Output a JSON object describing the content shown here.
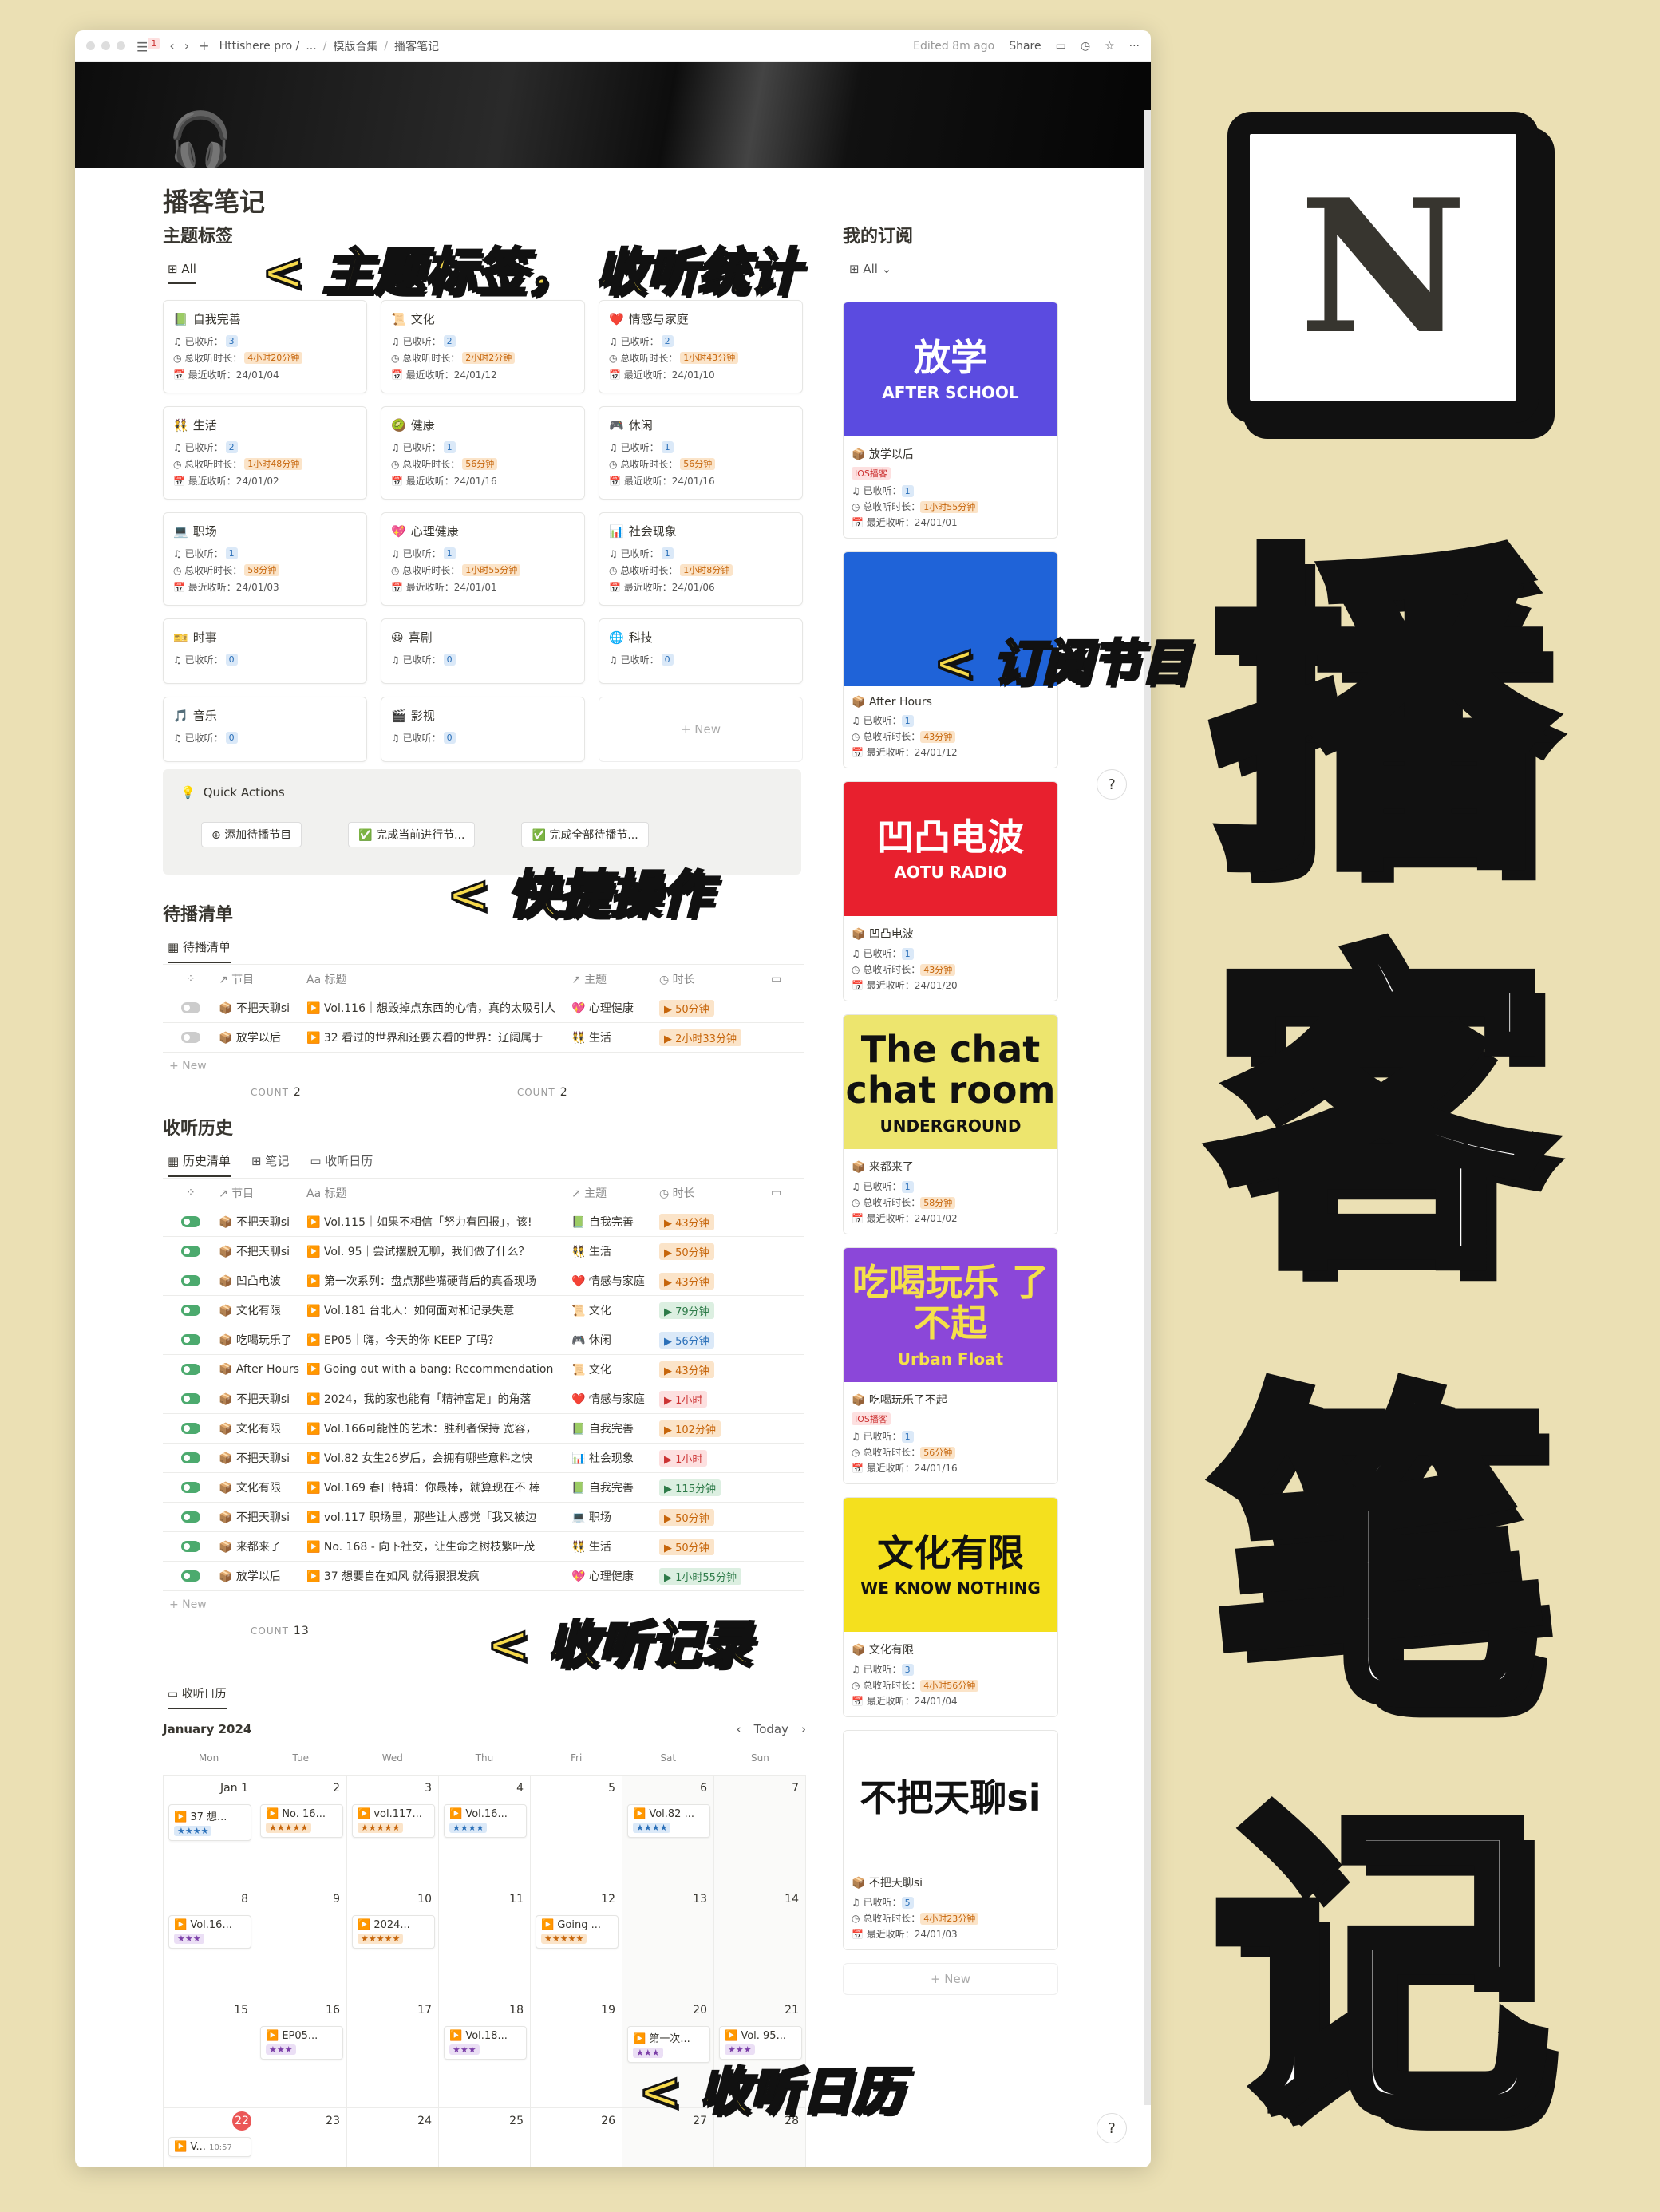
{
  "topbar": {
    "badge": "1",
    "workspace": "Httishere pro /",
    "ellipsis": "...",
    "sep1": "/",
    "crumb2": "模版合集",
    "sep2": "/",
    "crumb3": "播客笔记",
    "edited": "Edited 8m ago",
    "share": "Share"
  },
  "page": {
    "title": "播客笔记"
  },
  "topics": {
    "heading": "主题标签",
    "view": "All",
    "stats": {
      "listened": "已收听：",
      "duration": "总收听时长：",
      "recent": "最近收听："
    },
    "items": [
      {
        "icon": "📗",
        "name": "自我完善",
        "count": "3",
        "dur": "4小时20分钟",
        "date": "24/01/04"
      },
      {
        "icon": "📜",
        "name": "文化",
        "count": "2",
        "dur": "2小时2分钟",
        "date": "24/01/12"
      },
      {
        "icon": "❤️",
        "name": "情感与家庭",
        "count": "2",
        "dur": "1小时43分钟",
        "date": "24/01/10"
      },
      {
        "icon": "👯",
        "name": "生活",
        "count": "2",
        "dur": "1小时48分钟",
        "date": "24/01/02"
      },
      {
        "icon": "🥝",
        "name": "健康",
        "count": "1",
        "dur": "56分钟",
        "date": "24/01/16"
      },
      {
        "icon": "🎮",
        "name": "休闲",
        "count": "1",
        "dur": "56分钟",
        "date": "24/01/16"
      },
      {
        "icon": "💻",
        "name": "职场",
        "count": "1",
        "dur": "58分钟",
        "date": "24/01/03"
      },
      {
        "icon": "💖",
        "name": "心理健康",
        "count": "1",
        "dur": "1小时55分钟",
        "date": "24/01/01"
      },
      {
        "icon": "📊",
        "name": "社会现象",
        "count": "1",
        "dur": "1小时8分钟",
        "date": "24/01/06"
      },
      {
        "icon": "🎫",
        "name": "时事",
        "count": "0"
      },
      {
        "icon": "😀",
        "name": "喜剧",
        "count": "0"
      },
      {
        "icon": "🌐",
        "name": "科技",
        "count": "0"
      },
      {
        "icon": "🎵",
        "name": "音乐",
        "count": "0"
      },
      {
        "icon": "🎬",
        "name": "影视",
        "count": "0"
      }
    ],
    "new": "+ New"
  },
  "quick": {
    "heading": "Quick Actions",
    "b1": "添加待播节目",
    "b2": "完成当前进行节...",
    "b3": "完成全部待播节..."
  },
  "queue": {
    "heading": "待播清单",
    "view": "待播清单",
    "cols": {
      "c1": "↗ 节目",
      "c2": "Aa 标题",
      "c3": "↗ 主题",
      "c4": "◷ 时长"
    },
    "rows": [
      {
        "show": "不把天聊si",
        "title": "Vol.116｜想毁掉点东西的心情，真的太吸引人",
        "topic": "心理健康",
        "tcolor": "#c33",
        "dur": "50分钟"
      },
      {
        "show": "放学以后",
        "title": "32 看过的世界和还要去看的世界：辽阔属于",
        "topic": "生活",
        "tcolor": "#7b3fa8",
        "dur": "2小时33分钟"
      }
    ],
    "new": "+ New",
    "count_label": "COUNT",
    "count1": "2",
    "count2": "2"
  },
  "history": {
    "heading": "收听历史",
    "tab1": "历史清单",
    "tab2": "笔记",
    "tab3": "收听日历",
    "rows": [
      {
        "show": "不把天聊si",
        "title": "Vol.115｜如果不相信「努力有回报」，该!",
        "topic": "自我完善",
        "dur": "43分钟",
        "dc": "or"
      },
      {
        "show": "不把天聊si",
        "title": "Vol. 95｜尝试摆脱无聊，我们做了什么？",
        "topic": "生活",
        "dur": "50分钟",
        "dc": "or"
      },
      {
        "show": "凹凸电波",
        "title": "第一次系列：盘点那些嘴硬背后的真香现场",
        "topic": "情感与家庭",
        "dur": "43分钟",
        "dc": "or"
      },
      {
        "show": "文化有限",
        "title": "Vol.181 台北人：如何面对和记录失意",
        "topic": "文化",
        "dur": "79分钟",
        "dc": "grn"
      },
      {
        "show": "吃喝玩乐了",
        "title": "EP05｜嗨，今天的你 KEEP 了吗？",
        "topic": "休闲",
        "dur": "56分钟",
        "dc": "blue"
      },
      {
        "show": "After Hours",
        "title": "Going out with a bang: Recommendation",
        "topic": "文化",
        "dur": "43分钟",
        "dc": "or"
      },
      {
        "show": "不把天聊si",
        "title": "2024，我的家也能有「精神富足」的角落",
        "topic": "情感与家庭",
        "dur": "1小时",
        "dc": "red"
      },
      {
        "show": "文化有限",
        "title": "Vol.166可能性的艺术：胜利者保持 宽容，",
        "topic": "自我完善",
        "dur": "102分钟",
        "dc": "or"
      },
      {
        "show": "不把天聊si",
        "title": "Vol.82 女生26岁后，会拥有哪些意料之快",
        "topic": "社会现象",
        "dur": "1小时",
        "dc": "red"
      },
      {
        "show": "文化有限",
        "title": "Vol.169 春日特辑：你最棒，就算现在不 棒",
        "topic": "自我完善",
        "dur": "115分钟",
        "dc": "grn"
      },
      {
        "show": "不把天聊si",
        "title": "vol.117 职场里，那些让人感觉「我又被边",
        "topic": "职场",
        "dur": "50分钟",
        "dc": "or"
      },
      {
        "show": "来都来了",
        "title": "No. 168 - 向下社交，让生命之树枝繁叶茂",
        "topic": "生活",
        "dur": "50分钟",
        "dc": "or"
      },
      {
        "show": "放学以后",
        "title": "37 想要自在如风 就得狠狠发疯",
        "topic": "心理健康",
        "dur": "1小时55分钟",
        "dc": "grn"
      }
    ],
    "new": "+ New",
    "count": "13"
  },
  "calendar": {
    "view": "收听日历",
    "month": "January 2024",
    "today": "Today",
    "dow": [
      "Mon",
      "Tue",
      "Wed",
      "Thu",
      "Fri",
      "Sat",
      "Sun"
    ],
    "days": [
      {
        "d": "Jan 1",
        "ev": "37 想...",
        "st": "★★★★",
        "c": "blue"
      },
      {
        "d": "2",
        "ev": "No. 16...",
        "st": "★★★★★",
        "c": "or"
      },
      {
        "d": "3",
        "ev": "vol.117...",
        "st": "★★★★★",
        "c": "or"
      },
      {
        "d": "4",
        "ev": "Vol.16...",
        "st": "★★★★",
        "c": "blue"
      },
      {
        "d": "5"
      },
      {
        "d": "6",
        "ev": "Vol.82 ...",
        "st": "★★★★",
        "c": "blue"
      },
      {
        "d": "7"
      },
      {
        "d": "8",
        "ev": "Vol.16...",
        "st": "★★★",
        "c": "pur"
      },
      {
        "d": "9"
      },
      {
        "d": "10",
        "ev": "2024...",
        "st": "★★★★★",
        "c": "or"
      },
      {
        "d": "11"
      },
      {
        "d": "12",
        "ev": "Going ...",
        "st": "★★★★★",
        "c": "or"
      },
      {
        "d": "13"
      },
      {
        "d": "14"
      },
      {
        "d": "15"
      },
      {
        "d": "16",
        "ev": "EP05...",
        "st": "★★★",
        "c": "pur"
      },
      {
        "d": "17"
      },
      {
        "d": "18",
        "ev": "Vol.18...",
        "st": "★★★",
        "c": "pur"
      },
      {
        "d": "19"
      },
      {
        "d": "20",
        "ev": "第一次...",
        "st": "★★★",
        "c": "pur"
      },
      {
        "d": "21",
        "ev": "Vol. 95...",
        "st": "★★★",
        "c": "pur"
      },
      {
        "d": "22",
        "today": true,
        "ev": "V...",
        "time": "10:57"
      },
      {
        "d": "23"
      },
      {
        "d": "24"
      },
      {
        "d": "25"
      },
      {
        "d": "26"
      },
      {
        "d": "27"
      },
      {
        "d": "28"
      }
    ]
  },
  "subs": {
    "heading": "我的订阅",
    "view": "All",
    "items": [
      {
        "img": "放学",
        "img2": "AFTER SCHOOL",
        "bg": "#5b4be0",
        "fg": "#fff",
        "name": "放学以后",
        "ios": "IOS播客",
        "count": "1",
        "dur": "1小时55分钟",
        "date": "24/01/01"
      },
      {
        "img": "",
        "img2": "",
        "bg": "#1f63d8",
        "fg": "#fff",
        "name": "After Hours",
        "count": "1",
        "dur": "43分钟",
        "date": "24/01/12"
      },
      {
        "img": "凹凸电波",
        "img2": "AOTU RADIO",
        "bg": "#e8202e",
        "fg": "#fff",
        "name": "凹凸电波",
        "count": "1",
        "dur": "43分钟",
        "date": "24/01/20"
      },
      {
        "img": "The chat chat room",
        "img2": "UNDERGROUND",
        "bg": "#ede56e",
        "fg": "#111",
        "name": "来都来了",
        "count": "1",
        "dur": "58分钟",
        "date": "24/01/02"
      },
      {
        "img": "吃喝玩乐 了不起",
        "img2": "Urban Float",
        "bg": "#8b47d9",
        "fg": "#f5e04a",
        "name": "吃喝玩乐了不起",
        "ios": "IOS播客",
        "count": "1",
        "dur": "56分钟",
        "date": "24/01/16"
      },
      {
        "img": "文化有限",
        "img2": "WE KNOW NOTHING",
        "bg": "#f4e01e",
        "fg": "#111",
        "name": "文化有限",
        "count": "3",
        "dur": "4小时56分钟",
        "date": "24/01/04"
      },
      {
        "img": "不把天聊si",
        "img2": "",
        "bg": "#fff",
        "fg": "#111",
        "name": "不把天聊si",
        "count": "5",
        "dur": "4小时23分钟",
        "date": "24/01/03"
      }
    ],
    "new": "+ New"
  },
  "annotations": {
    "a1": "< 主题标签， 收听统计",
    "a2": "< 订阅节目",
    "a3": "< 快捷操作",
    "a4": "< 收听记录",
    "a5": "< 收听日历"
  },
  "big": {
    "logo": "N",
    "c1": "播",
    "c2": "客",
    "c3": "笔",
    "c4": "记"
  }
}
